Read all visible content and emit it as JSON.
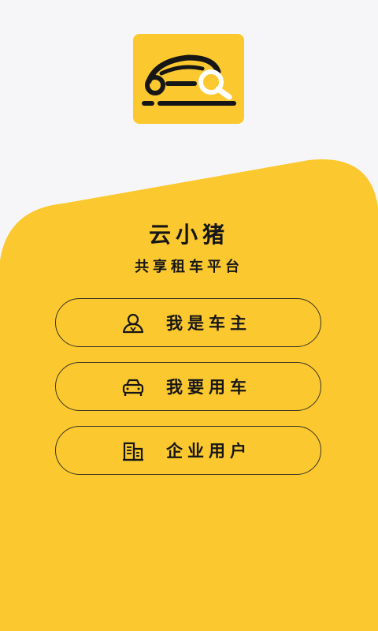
{
  "app": {
    "name": "云小猪",
    "slogan": "共享租车平台"
  },
  "logo": {
    "icon": "car-search-icon",
    "color": "#fbc82f"
  },
  "colors": {
    "brand_yellow": "#fbc82f",
    "background": "#f6f6f8",
    "text": "#161616"
  },
  "options": [
    {
      "label": "我是车主",
      "icon": "car-owner-icon"
    },
    {
      "label": "我要用车",
      "icon": "car-front-icon"
    },
    {
      "label": "企业用户",
      "icon": "building-icon"
    }
  ]
}
